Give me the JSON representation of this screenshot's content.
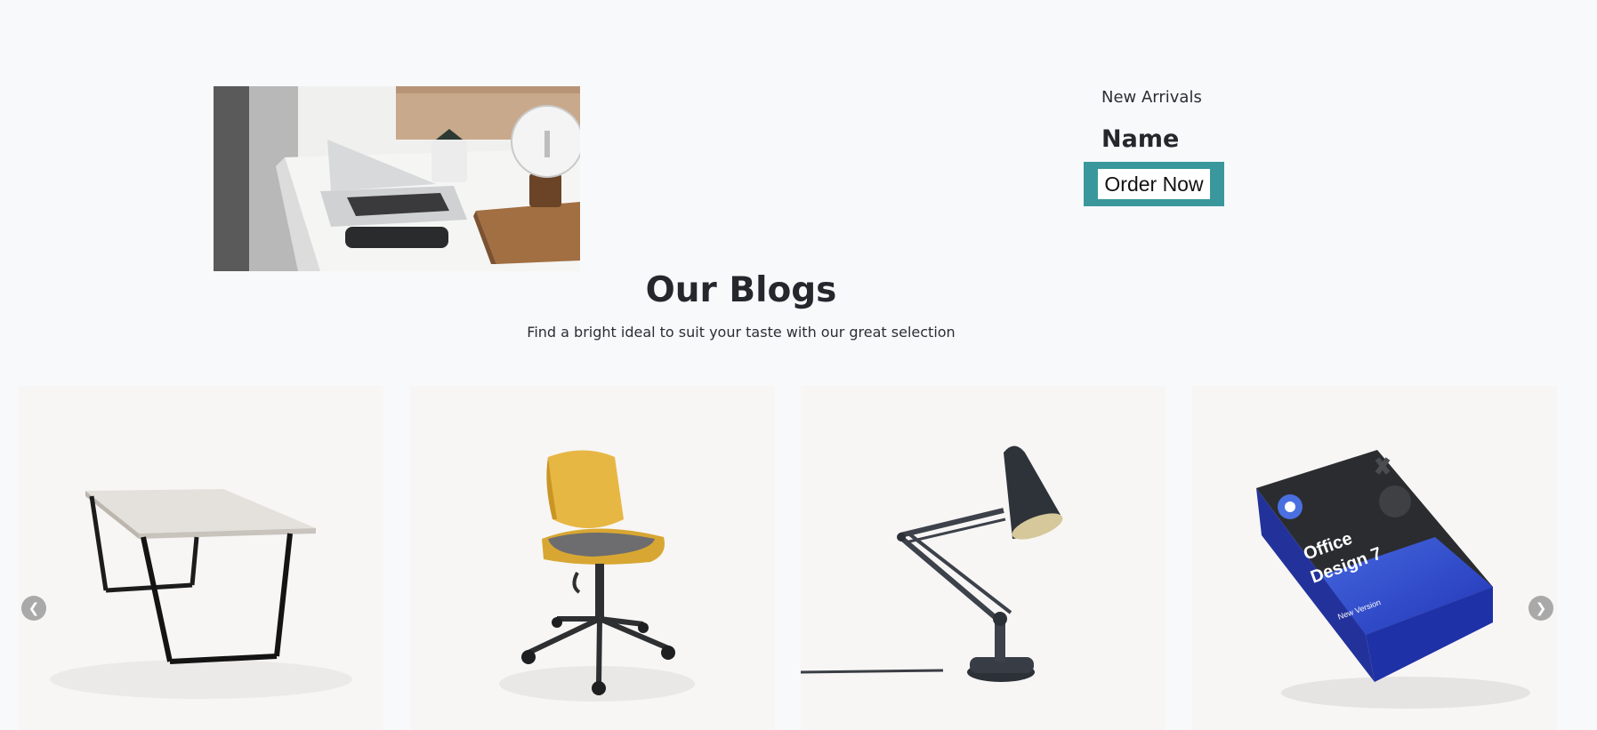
{
  "hero": {
    "kicker": "New Arrivals",
    "name": "Name",
    "cta_label": "Order Now",
    "accent_color": "#3a989c"
  },
  "blogs": {
    "title": "Our Blogs",
    "subtitle": "Find a bright ideal to suit your taste with our great selection"
  },
  "carousel": {
    "prev_icon": "chevron-left-icon",
    "next_icon": "chevron-right-icon",
    "items": [
      {
        "image": "table-image"
      },
      {
        "image": "office-chair-image"
      },
      {
        "image": "desk-lamp-image"
      },
      {
        "image": "software-box-image",
        "box_title_line1": "Office",
        "box_title_line2": "Design 7",
        "box_badge": "New Version"
      }
    ]
  }
}
